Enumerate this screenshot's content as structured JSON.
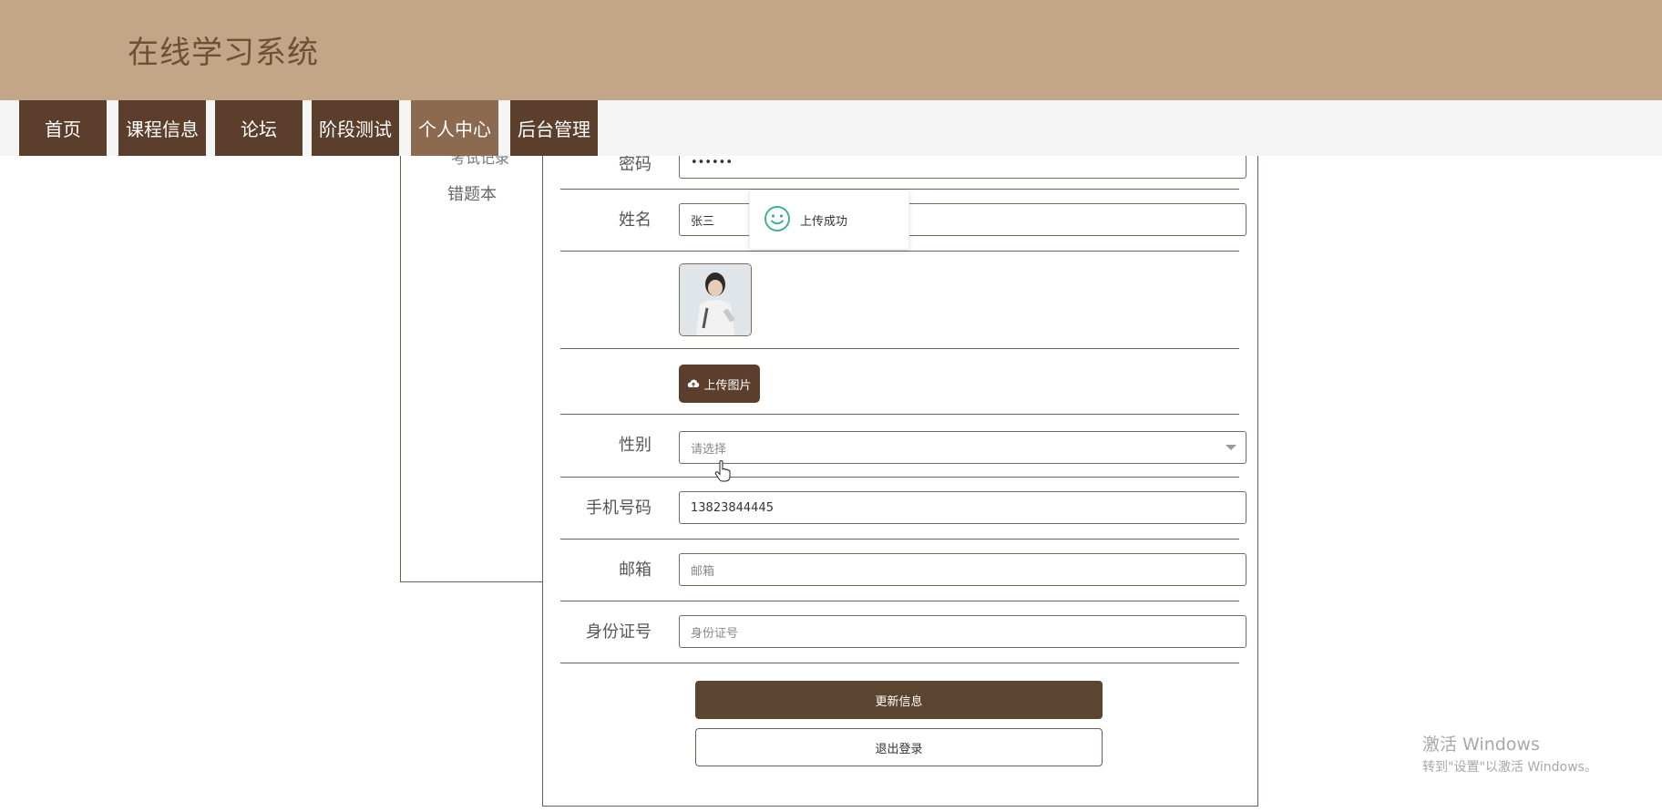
{
  "header": {
    "title": "在线学习系统"
  },
  "nav": {
    "items": [
      {
        "label": "首页"
      },
      {
        "label": "课程信息"
      },
      {
        "label": "论坛"
      },
      {
        "label": "阶段测试"
      },
      {
        "label": "个人中心"
      },
      {
        "label": "后台管理"
      }
    ],
    "active_index": 4
  },
  "sidebar": {
    "clipped_item": "考试记录",
    "items": [
      {
        "label": "错题本"
      }
    ]
  },
  "form": {
    "password": {
      "label": "密码",
      "value": "••••••"
    },
    "name": {
      "label": "姓名",
      "value": "张三"
    },
    "upload_button": {
      "label": "上传图片",
      "icon": "cloud-upload-icon"
    },
    "gender": {
      "label": "性别",
      "placeholder": "请选择"
    },
    "phone": {
      "label": "手机号码",
      "value": "13823844445"
    },
    "email": {
      "label": "邮箱",
      "placeholder": "邮箱"
    },
    "id_card": {
      "label": "身份证号",
      "placeholder": "身份证号"
    },
    "update_button": "更新信息",
    "logout_button": "退出登录"
  },
  "toast": {
    "message": "上传成功",
    "icon": "smile-icon"
  },
  "watermark": {
    "title": "激活 Windows",
    "subtitle": "转到\"设置\"以激活 Windows。"
  },
  "colors": {
    "header_bg": "#c3a688",
    "nav_bg": "#5b3e2b",
    "nav_active_bg": "#8b6a4f",
    "primary_button": "#5b4430",
    "success_green": "#3fb28f"
  }
}
